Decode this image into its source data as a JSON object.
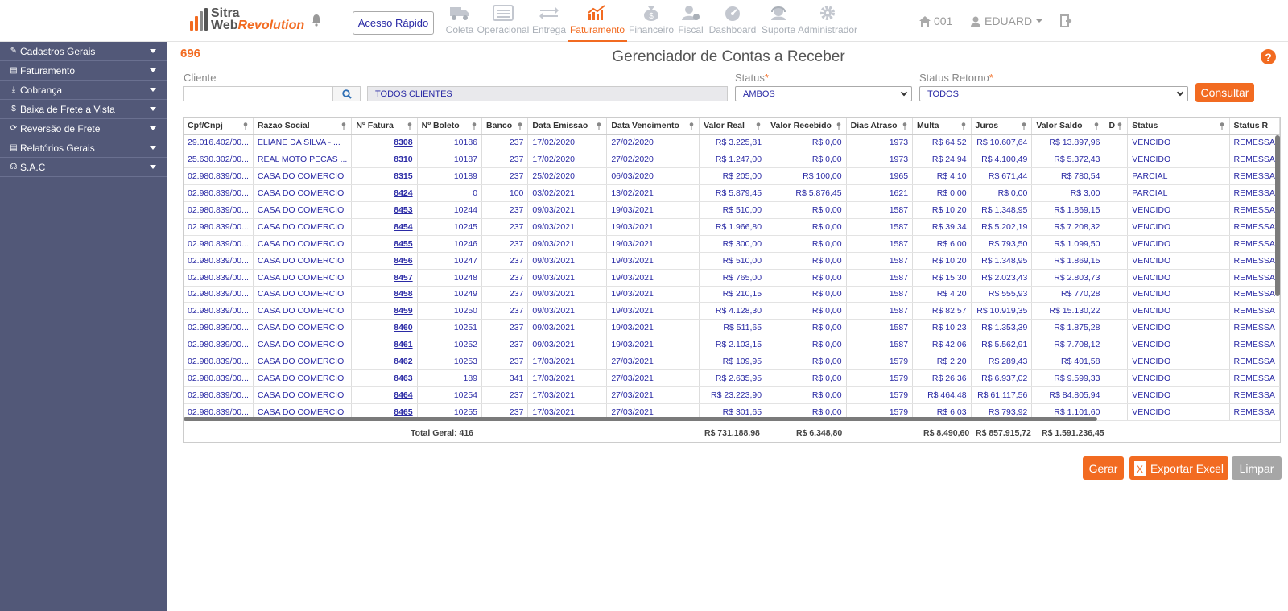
{
  "logo": {
    "line1": "Sitra",
    "web": "Web",
    "revolution": "Revolution",
    "bar_colors": [
      "#f26b21",
      "#f26b21",
      "#888888",
      "#555555"
    ]
  },
  "header": {
    "quick_access": "Acesso Rápido",
    "menu": [
      {
        "label": "Coleta",
        "icon": "truck-icon"
      },
      {
        "label": "Operacional",
        "icon": "list-icon"
      },
      {
        "label": "Entrega",
        "icon": "exchange-icon"
      },
      {
        "label": "Faturamento",
        "icon": "chart-dollar-icon",
        "active": true
      },
      {
        "label": "Financeiro",
        "icon": "money-bag-icon"
      },
      {
        "label": "Fiscal",
        "icon": "user-gear-icon"
      },
      {
        "label": "Dashboard",
        "icon": "gauge-icon"
      },
      {
        "label": "Suporte",
        "icon": "headset-icon"
      },
      {
        "label": "Administrador",
        "icon": "gear-icon"
      }
    ],
    "home_code": "001",
    "user": "EDUARD"
  },
  "sidebar": {
    "items": [
      {
        "label": "Cadastros Gerais",
        "icon": "edit-icon"
      },
      {
        "label": "Faturamento",
        "icon": "file-icon"
      },
      {
        "label": "Cobrança",
        "icon": "download-icon"
      },
      {
        "label": "Baixa de Frete a Vista",
        "icon": "dollar-icon"
      },
      {
        "label": "Reversão de Frete",
        "icon": "refresh-icon"
      },
      {
        "label": "Relatórios Gerais",
        "icon": "report-icon"
      },
      {
        "label": "S.A.C",
        "icon": "headset-icon"
      }
    ]
  },
  "page": {
    "number": "696",
    "title": "Gerenciador de Contas a Receber",
    "help": "?"
  },
  "filters": {
    "cliente_label": "Cliente",
    "cliente_value": "",
    "todos_clientes": "TODOS CLIENTES",
    "status_label": "Status",
    "status_value": "AMBOS",
    "status_retorno_label": "Status Retorno",
    "status_retorno_value": "TODOS",
    "required_mark": "*",
    "consultar": "Consultar"
  },
  "table": {
    "columns": [
      "Cpf/Cnpj",
      "Razao Social",
      "Nº Fatura",
      "Nº Boleto",
      "Banco",
      "Data Emissao",
      "Data Vencimento",
      "Valor Real",
      "Valor Recebido",
      "Dias Atraso",
      "Multa",
      "Juros",
      "Valor Saldo",
      "D",
      "Status",
      "Status R"
    ],
    "rows": [
      [
        "29.016.402/00...",
        "ELIANE DA SILVA - ...",
        "8308",
        "10186",
        "237",
        "17/02/2020",
        "27/02/2020",
        "R$ 3.225,81",
        "R$ 0,00",
        "1973",
        "R$ 64,52",
        "R$ 10.607,64",
        "R$ 13.897,96",
        "",
        "VENCIDO",
        "REMESSA"
      ],
      [
        "25.630.302/00...",
        "REAL MOTO PECAS ...",
        "8310",
        "10187",
        "237",
        "17/02/2020",
        "27/02/2020",
        "R$ 1.247,00",
        "R$ 0,00",
        "1973",
        "R$ 24,94",
        "R$ 4.100,49",
        "R$ 5.372,43",
        "",
        "VENCIDO",
        "REMESSA"
      ],
      [
        "02.980.839/00...",
        "CASA DO COMERCIO",
        "8315",
        "10189",
        "237",
        "25/02/2020",
        "06/03/2020",
        "R$ 205,00",
        "R$ 100,00",
        "1965",
        "R$ 4,10",
        "R$ 671,44",
        "R$ 780,54",
        "",
        "PARCIAL",
        "REMESSA"
      ],
      [
        "02.980.839/00...",
        "CASA DO COMERCIO",
        "8424",
        "0",
        "100",
        "03/02/2021",
        "13/02/2021",
        "R$ 5.879,45",
        "R$ 5.876,45",
        "1621",
        "R$ 0,00",
        "R$ 0,00",
        "R$ 3,00",
        "",
        "PARCIAL",
        "REMESSA"
      ],
      [
        "02.980.839/00...",
        "CASA DO COMERCIO",
        "8453",
        "10244",
        "237",
        "09/03/2021",
        "19/03/2021",
        "R$ 510,00",
        "R$ 0,00",
        "1587",
        "R$ 10,20",
        "R$ 1.348,95",
        "R$ 1.869,15",
        "",
        "VENCIDO",
        "REMESSA"
      ],
      [
        "02.980.839/00...",
        "CASA DO COMERCIO",
        "8454",
        "10245",
        "237",
        "09/03/2021",
        "19/03/2021",
        "R$ 1.966,80",
        "R$ 0,00",
        "1587",
        "R$ 39,34",
        "R$ 5.202,19",
        "R$ 7.208,32",
        "",
        "VENCIDO",
        "REMESSA"
      ],
      [
        "02.980.839/00...",
        "CASA DO COMERCIO",
        "8455",
        "10246",
        "237",
        "09/03/2021",
        "19/03/2021",
        "R$ 300,00",
        "R$ 0,00",
        "1587",
        "R$ 6,00",
        "R$ 793,50",
        "R$ 1.099,50",
        "",
        "VENCIDO",
        "REMESSA"
      ],
      [
        "02.980.839/00...",
        "CASA DO COMERCIO",
        "8456",
        "10247",
        "237",
        "09/03/2021",
        "19/03/2021",
        "R$ 510,00",
        "R$ 0,00",
        "1587",
        "R$ 10,20",
        "R$ 1.348,95",
        "R$ 1.869,15",
        "",
        "VENCIDO",
        "REMESSA"
      ],
      [
        "02.980.839/00...",
        "CASA DO COMERCIO",
        "8457",
        "10248",
        "237",
        "09/03/2021",
        "19/03/2021",
        "R$ 765,00",
        "R$ 0,00",
        "1587",
        "R$ 15,30",
        "R$ 2.023,43",
        "R$ 2.803,73",
        "",
        "VENCIDO",
        "REMESSA"
      ],
      [
        "02.980.839/00...",
        "CASA DO COMERCIO",
        "8458",
        "10249",
        "237",
        "09/03/2021",
        "19/03/2021",
        "R$ 210,15",
        "R$ 0,00",
        "1587",
        "R$ 4,20",
        "R$ 555,93",
        "R$ 770,28",
        "",
        "VENCIDO",
        "REMESSA"
      ],
      [
        "02.980.839/00...",
        "CASA DO COMERCIO",
        "8459",
        "10250",
        "237",
        "09/03/2021",
        "19/03/2021",
        "R$ 4.128,30",
        "R$ 0,00",
        "1587",
        "R$ 82,57",
        "R$ 10.919,35",
        "R$ 15.130,22",
        "",
        "VENCIDO",
        "REMESSA"
      ],
      [
        "02.980.839/00...",
        "CASA DO COMERCIO",
        "8460",
        "10251",
        "237",
        "09/03/2021",
        "19/03/2021",
        "R$ 511,65",
        "R$ 0,00",
        "1587",
        "R$ 10,23",
        "R$ 1.353,39",
        "R$ 1.875,28",
        "",
        "VENCIDO",
        "REMESSA"
      ],
      [
        "02.980.839/00...",
        "CASA DO COMERCIO",
        "8461",
        "10252",
        "237",
        "09/03/2021",
        "19/03/2021",
        "R$ 2.103,15",
        "R$ 0,00",
        "1587",
        "R$ 42,06",
        "R$ 5.562,91",
        "R$ 7.708,12",
        "",
        "VENCIDO",
        "REMESSA"
      ],
      [
        "02.980.839/00...",
        "CASA DO COMERCIO",
        "8462",
        "10253",
        "237",
        "17/03/2021",
        "27/03/2021",
        "R$ 109,95",
        "R$ 0,00",
        "1579",
        "R$ 2,20",
        "R$ 289,43",
        "R$ 401,58",
        "",
        "VENCIDO",
        "REMESSA"
      ],
      [
        "02.980.839/00...",
        "CASA DO COMERCIO",
        "8463",
        "189",
        "341",
        "17/03/2021",
        "27/03/2021",
        "R$ 2.635,95",
        "R$ 0,00",
        "1579",
        "R$ 26,36",
        "R$ 6.937,02",
        "R$ 9.599,33",
        "",
        "VENCIDO",
        "REMESSA"
      ],
      [
        "02.980.839/00...",
        "CASA DO COMERCIO",
        "8464",
        "10254",
        "237",
        "17/03/2021",
        "27/03/2021",
        "R$ 23.223,90",
        "R$ 0,00",
        "1579",
        "R$ 464,48",
        "R$ 61.117,56",
        "R$ 84.805,94",
        "",
        "VENCIDO",
        "REMESSA"
      ],
      [
        "02.980.839/00...",
        "CASA DO COMERCIO",
        "8465",
        "10255",
        "237",
        "17/03/2021",
        "27/03/2021",
        "R$ 301,65",
        "R$ 0,00",
        "1579",
        "R$ 6,03",
        "R$ 793,92",
        "R$ 1.101,60",
        "",
        "VENCIDO",
        "REMESSA"
      ]
    ],
    "totals": {
      "label": "Total Geral: 416",
      "valor_real": "R$ 731.188,98",
      "valor_recebido": "R$ 6.348,80",
      "multa": "R$ 8.490,60",
      "juros": "R$ 857.915,72",
      "valor_saldo": "R$ 1.591.236,45"
    }
  },
  "actions": {
    "gerar": "Gerar",
    "exportar": "Exportar Excel",
    "limpar": "Limpar"
  },
  "colors": {
    "accent": "#f26b21",
    "sidebar": "#525878",
    "link": "#2a2aa5"
  }
}
